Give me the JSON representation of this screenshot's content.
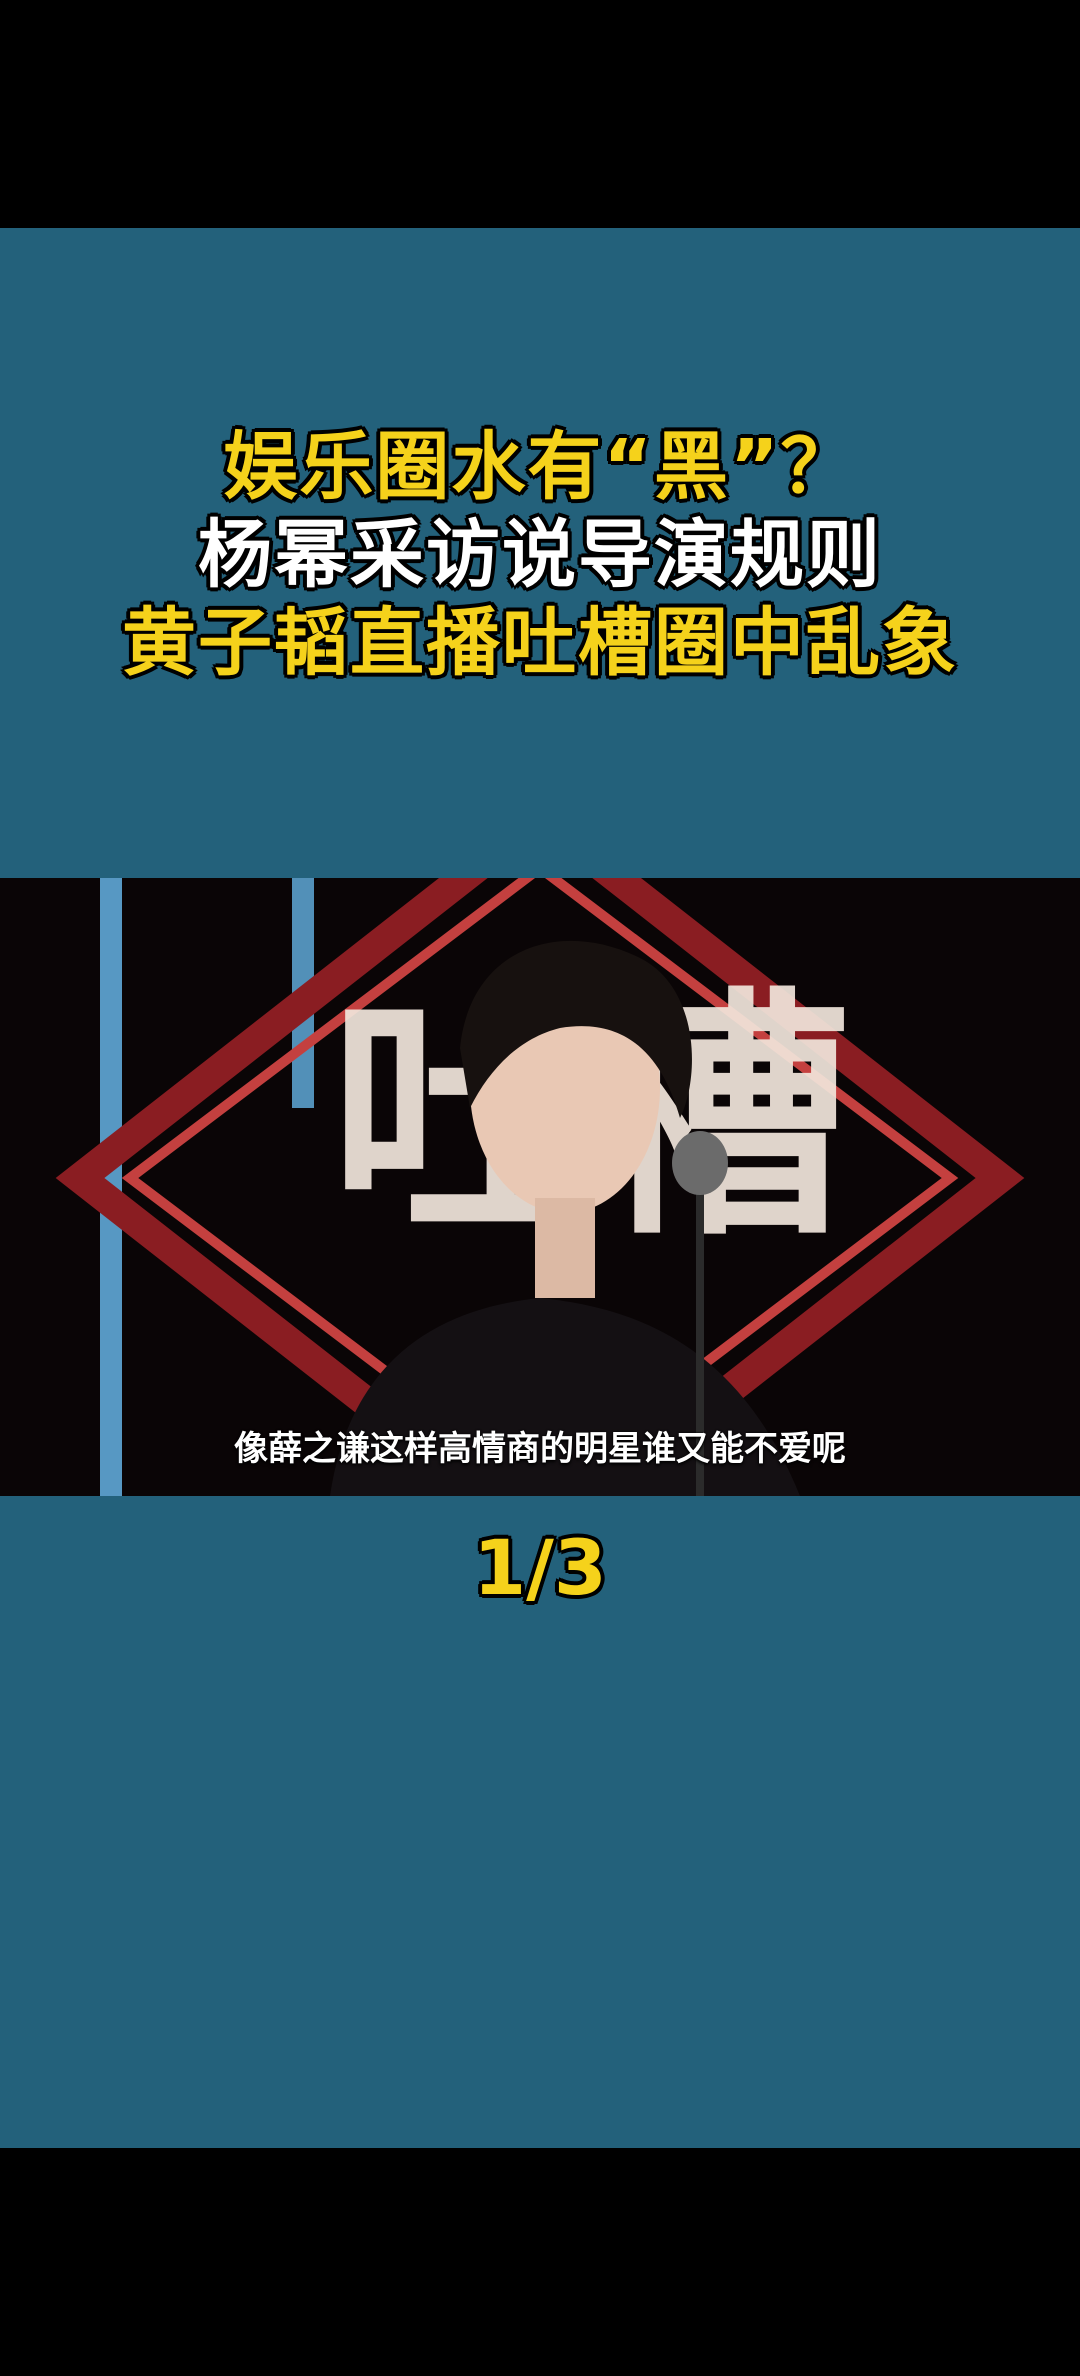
{
  "title": {
    "line1": "娱乐圈水有“黑”？",
    "line2": "杨幂采访说导演规则",
    "line3": "黄子韬直播吐槽圈中乱象"
  },
  "video": {
    "backdrop_text": "吐槽",
    "subtitle": "像薛之谦这样高情商的明星谁又能不爱呢"
  },
  "page_indicator": "1/3",
  "colors": {
    "panel_bg": "#23617b",
    "title_yellow": "#f5d21b",
    "letterbox": "#000000"
  }
}
